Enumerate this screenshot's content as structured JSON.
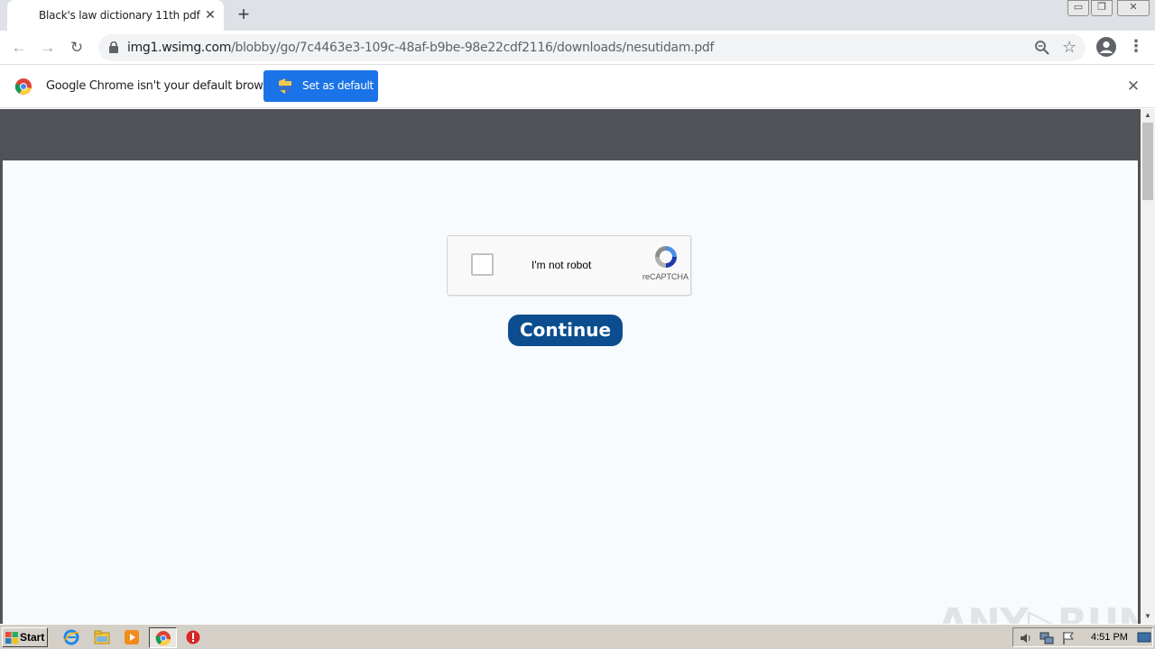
{
  "browser": {
    "tab": {
      "title": "Black's law dictionary 11th pdf",
      "close": "✕"
    },
    "new_tab": "+",
    "window_controls": {
      "minimize": "▭",
      "maximize": "❐",
      "close": "✕"
    },
    "toolbar": {
      "back": "←",
      "forward": "→",
      "reload": "↻",
      "url_host": "img1.wsimg.com",
      "url_path": "/blobby/go/7c4463e3-109c-48af-b9be-98e22cdf2116/downloads/nesutidam.pdf",
      "bookmark": "☆",
      "menu": "⋮"
    },
    "infobar": {
      "message": "Google Chrome isn't your default browser",
      "button_label": "Set as default",
      "close": "✕"
    }
  },
  "page": {
    "captcha": {
      "label": "I'm not robot",
      "brand": "reCAPTCHA"
    },
    "continue_label": "Continue",
    "watermark": "ANY▷RUN"
  },
  "scrollbar": {
    "up": "▲",
    "down": "▼"
  },
  "taskbar": {
    "start_label": "Start",
    "clock": "4:51 PM",
    "apps": [
      "internet-explorer-icon",
      "explorer-folder-icon",
      "media-player-icon",
      "chrome-icon",
      "stop-icon"
    ]
  },
  "colors": {
    "tabstrip": "#dee1e6",
    "infobar_button": "#1a73e8",
    "page_header": "#4f5256",
    "page_background": "#f8fbfd",
    "continue_button": "#0b4d8f",
    "taskbar": "#d4d0c8"
  }
}
